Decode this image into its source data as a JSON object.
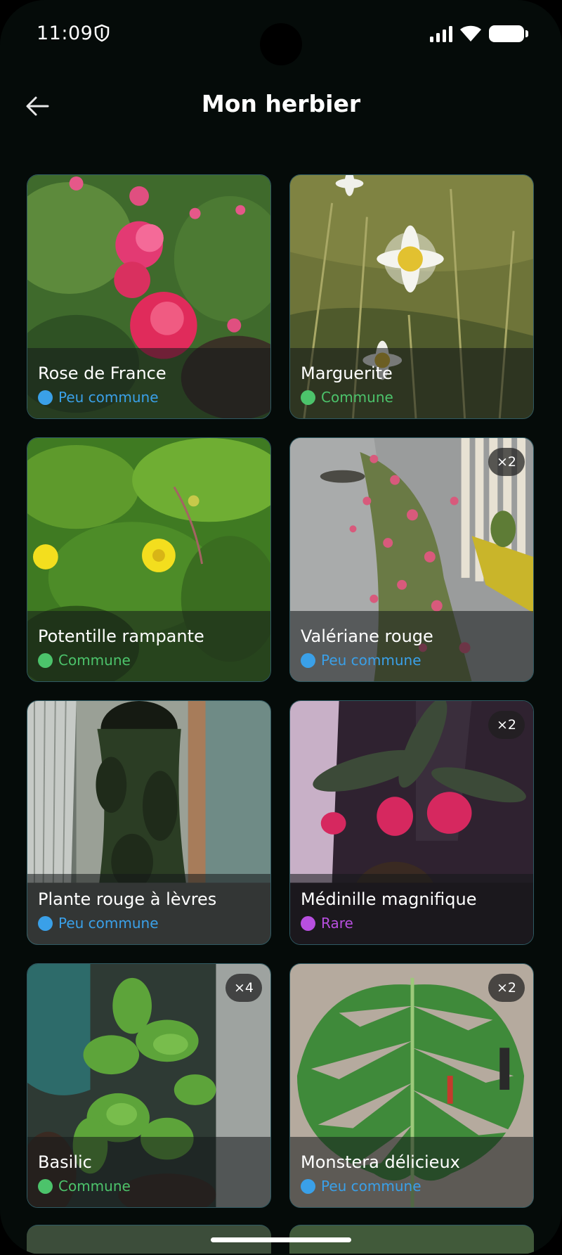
{
  "status_bar": {
    "time": "11:09"
  },
  "header": {
    "title": "Mon herbier"
  },
  "rarity_colors": {
    "Peu commune": "#3aa0e8",
    "Commune": "#4cc36b",
    "Rare": "#b84fe0"
  },
  "plants": [
    {
      "name": "Rose de France",
      "rarity": "Peu commune",
      "count": ""
    },
    {
      "name": "Marguerite",
      "rarity": "Commune",
      "count": ""
    },
    {
      "name": "Potentille rampante",
      "rarity": "Commune",
      "count": ""
    },
    {
      "name": "Valériane rouge",
      "rarity": "Peu commune",
      "count": "×2"
    },
    {
      "name": "Plante rouge à lèvres",
      "rarity": "Peu commune",
      "count": ""
    },
    {
      "name": "Médinille magnifique",
      "rarity": "Rare",
      "count": "×2"
    },
    {
      "name": "Basilic",
      "rarity": "Commune",
      "count": "×4"
    },
    {
      "name": "Monstera délicieux",
      "rarity": "Peu commune",
      "count": "×2"
    }
  ]
}
